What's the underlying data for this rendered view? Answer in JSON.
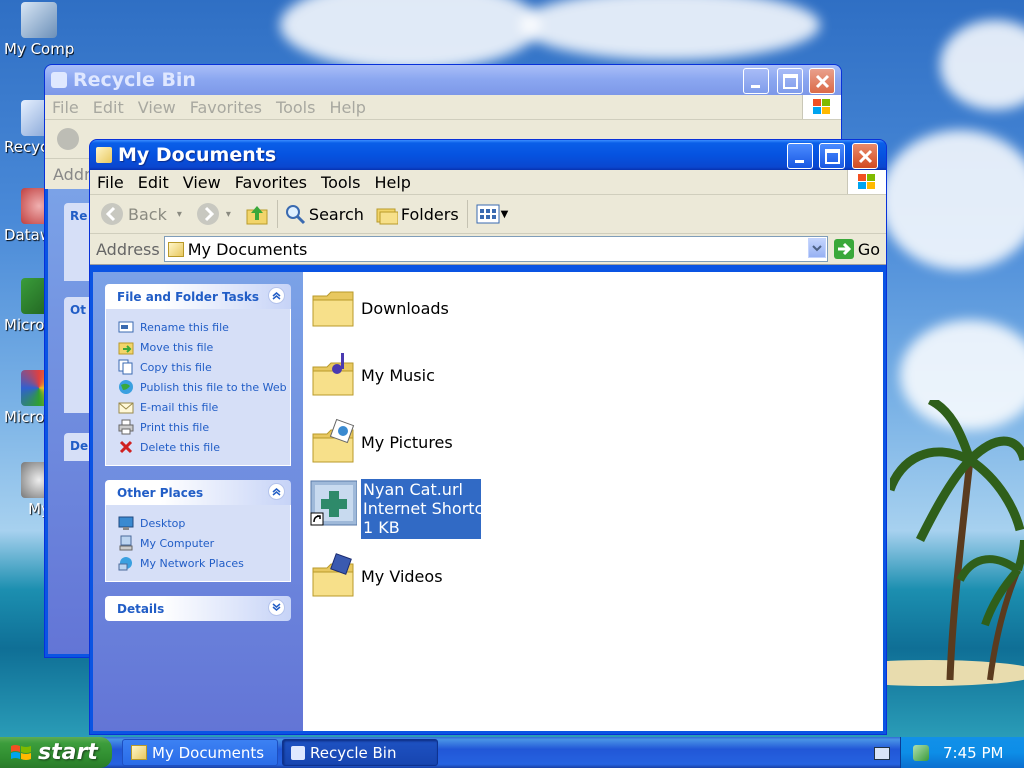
{
  "desktop": {
    "icons": [
      {
        "label": "My Computer"
      },
      {
        "label": "Recycle Bin"
      },
      {
        "label": "Datawatch"
      },
      {
        "label": "Microsoft Visual"
      },
      {
        "label": "Microsoft Visual"
      },
      {
        "label": "My"
      }
    ]
  },
  "recycle_window": {
    "title": "Recycle Bin",
    "menu": [
      "File",
      "Edit",
      "View",
      "Favorites",
      "Tools",
      "Help"
    ],
    "address_label": "Addr",
    "panel_labels": [
      "Re",
      "Ot",
      "De"
    ]
  },
  "main_window": {
    "title": "My Documents",
    "menu": [
      "File",
      "Edit",
      "View",
      "Favorites",
      "Tools",
      "Help"
    ],
    "toolbar": {
      "back": "Back",
      "search": "Search",
      "folders": "Folders"
    },
    "address": {
      "label": "Address",
      "value": "My Documents",
      "go": "Go"
    },
    "panels": [
      {
        "title": "File and Folder Tasks",
        "links": [
          "Rename this file",
          "Move this file",
          "Copy this file",
          "Publish this file to the Web",
          "E-mail this file",
          "Print this file",
          "Delete this file"
        ]
      },
      {
        "title": "Other Places",
        "links": [
          "Desktop",
          "My Computer",
          "My Network Places"
        ]
      },
      {
        "title": "Details",
        "links": []
      }
    ],
    "files": [
      {
        "name": "Downloads"
      },
      {
        "name": "My Music"
      },
      {
        "name": "My Pictures"
      },
      {
        "name": "Nyan Cat.url",
        "type": "Internet Shortcut",
        "size": "1 KB",
        "selected": true
      },
      {
        "name": "My Videos"
      }
    ]
  },
  "taskbar": {
    "start_label": "start",
    "tasks": [
      {
        "label": "My Documents",
        "active": false
      },
      {
        "label": "Recycle Bin",
        "active": true
      }
    ],
    "clock": "7:45 PM"
  },
  "colors": {
    "title_blue": "#0a54e3",
    "selection": "#316ac5",
    "task_link": "#215dc6",
    "start_green": "#3c9d3c"
  }
}
